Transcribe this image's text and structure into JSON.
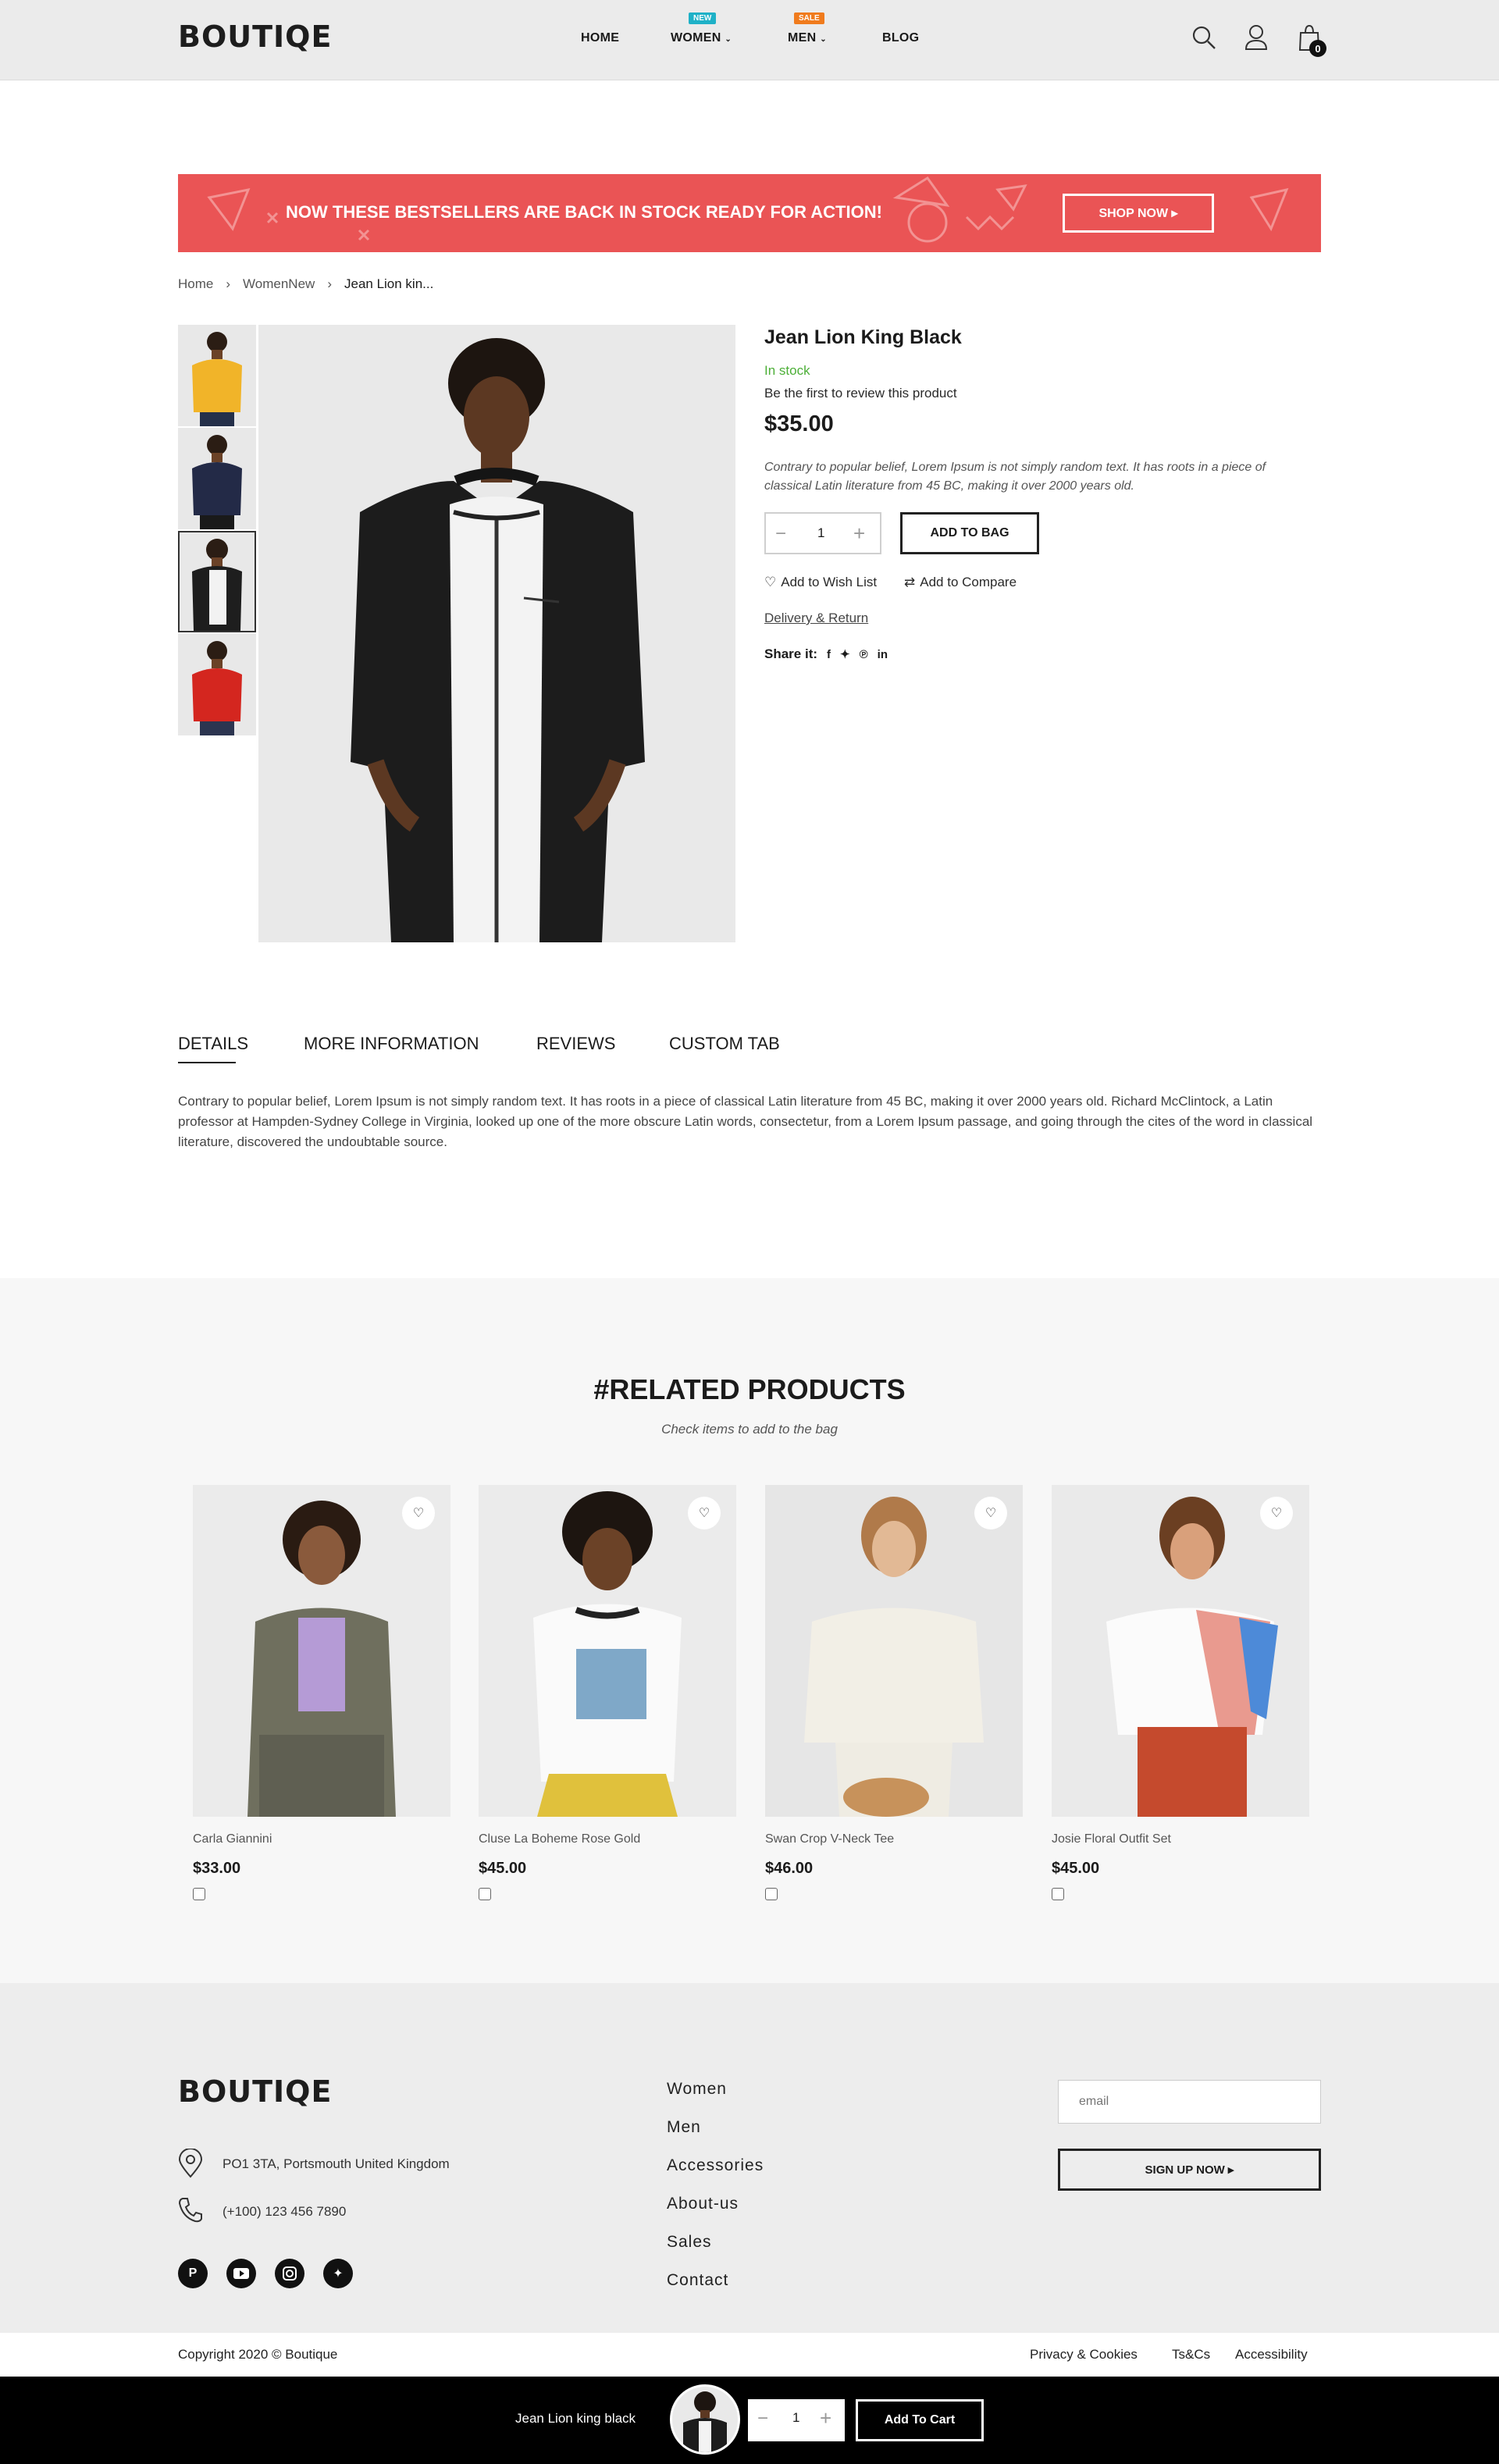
{
  "header": {
    "logo": "BOUTIQE",
    "nav": [
      {
        "label": "HOME"
      },
      {
        "label": "WOMEN",
        "badge": "NEW",
        "badge_color": "#1fb1c7"
      },
      {
        "label": "MEN",
        "badge": "SALE",
        "badge_color": "#f07b1d"
      },
      {
        "label": "BLOG"
      }
    ],
    "cart_count": "0"
  },
  "promo": {
    "text": "NOW THESE BESTSELLERS ARE BACK IN STOCK READY FOR ACTION!",
    "button": "SHOP NOW ▸",
    "color": "#ea5455"
  },
  "breadcrumb": [
    "Home",
    "WomenNew",
    "Jean Lion kin..."
  ],
  "product": {
    "name": "Jean Lion King Black",
    "stock": "In stock",
    "review_prompt": "Be the first to review this product",
    "price": "$35.00",
    "description": "Contrary to popular belief, Lorem Ipsum is not simply random text. It has roots in a piece of classical Latin literature from 45 BC, making it over 2000 years old.",
    "quantity": "1",
    "add_to_bag": "ADD TO BAG",
    "wish_list": "Add to Wish List",
    "compare": "Add to Compare",
    "delivery": "Delivery & Return",
    "share_label": "Share it:"
  },
  "tabs": [
    "DETAILS",
    "MORE INFORMATION",
    "REVIEWS",
    "CUSTOM TAB"
  ],
  "details_text": "Contrary to popular belief, Lorem Ipsum is not simply random text. It has roots in a piece of classical Latin literature from 45 BC, making it over 2000 years old. Richard McClintock, a Latin professor at Hampden-Sydney College in Virginia, looked up one of the more obscure Latin words, consectetur, from a Lorem Ipsum passage, and going through the cites of the word in classical literature, discovered the undoubtable source.",
  "related": {
    "title": "#RELATED PRODUCTS",
    "subtitle": "Check items to add to the bag",
    "items": [
      {
        "name": "Carla Giannini",
        "price": "$33.00"
      },
      {
        "name": "Cluse La Boheme Rose Gold",
        "price": "$45.00"
      },
      {
        "name": "Swan Crop V-Neck Tee",
        "price": "$46.00"
      },
      {
        "name": "Josie Floral Outfit Set",
        "price": "$45.00"
      }
    ]
  },
  "footer": {
    "logo": "BOUTIQE",
    "address": "PO1 3TA, Portsmouth United Kingdom",
    "phone": "(+100) 123 456 7890",
    "links": [
      "Women",
      "Men",
      "Accessories",
      "About-us",
      "Sales",
      "Contact"
    ],
    "email_placeholder": "email",
    "signup": "SIGN UP NOW ▸",
    "copyright": "Copyright 2020 © Boutique",
    "legal": [
      "Privacy & Cookies",
      "Ts&Cs",
      "Accessibility"
    ]
  },
  "sticky": {
    "name": "Jean Lion king black",
    "quantity": "1",
    "button": "Add To Cart"
  }
}
